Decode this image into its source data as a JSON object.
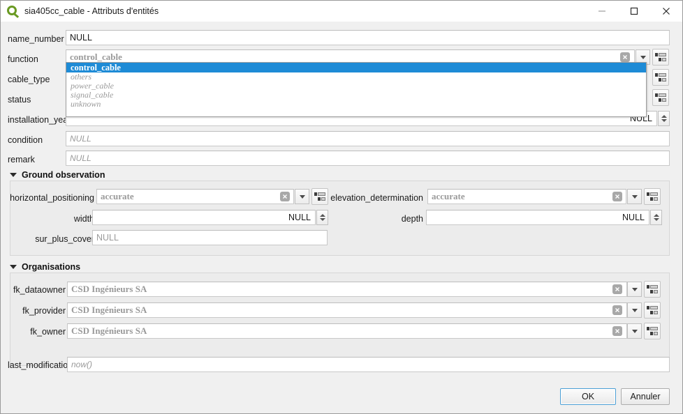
{
  "window": {
    "title": "sia405cc_cable - Attributs d'entités",
    "logo_icon": "qgis-logo-icon",
    "controls": [
      {
        "name": "minimize-button",
        "icon": "minimize-icon",
        "label": "—"
      },
      {
        "name": "maximize-button",
        "icon": "maximize-icon",
        "label": "☐"
      },
      {
        "name": "close-button",
        "icon": "close-icon",
        "label": "✕"
      }
    ]
  },
  "icons": {
    "clear": "clear-value-icon",
    "dropdown": "chevron-down-icon",
    "form_view": "open-form-icon",
    "spinner": "spinner-updown-icon",
    "collapse": "triangle-down-icon"
  },
  "fields": {
    "name_number": {
      "label": "name_number",
      "value": "NULL",
      "value_kind": "value"
    },
    "function": {
      "label": "function",
      "value": "control_cable",
      "value_kind": "combo-placeholder"
    },
    "cable_type": {
      "label": "cable_type",
      "value": "",
      "value_kind": "hidden-behind-popup"
    },
    "status": {
      "label": "status",
      "value": "",
      "value_kind": "hidden-behind-popup"
    },
    "installation_year": {
      "label": "installation_year",
      "value": "NULL",
      "value_kind": "numeric"
    },
    "condition": {
      "label": "condition",
      "value": "NULL",
      "value_kind": "placeholder"
    },
    "remark": {
      "label": "remark",
      "value": "NULL",
      "value_kind": "placeholder"
    },
    "horizontal_positioning": {
      "label": "horizontal_positioning",
      "value": "accurate",
      "value_kind": "combo-placeholder"
    },
    "elevation_determination": {
      "label": "elevation_determination",
      "value": "accurate",
      "value_kind": "combo-placeholder"
    },
    "width": {
      "label": "width",
      "value": "NULL",
      "value_kind": "numeric"
    },
    "depth": {
      "label": "depth",
      "value": "NULL",
      "value_kind": "numeric"
    },
    "sur_plus_cover": {
      "label": "sur_plus_cover",
      "value": "NULL",
      "value_kind": "placeholder-plain"
    },
    "fk_dataowner": {
      "label": "fk_dataowner",
      "value": "CSD Ingénieurs SA",
      "value_kind": "relation-ref"
    },
    "fk_provider": {
      "label": "fk_provider",
      "value": "CSD Ingénieurs SA",
      "value_kind": "relation-ref"
    },
    "fk_owner": {
      "label": "fk_owner",
      "value": "CSD Ingénieurs SA",
      "value_kind": "relation-ref"
    },
    "last_modification": {
      "label": "last_modification",
      "value": "now()",
      "value_kind": "placeholder"
    }
  },
  "groups": {
    "ground_observation": {
      "title": "Ground observation",
      "expanded": true
    },
    "organisations": {
      "title": "Organisations",
      "expanded": true
    }
  },
  "function_dropdown": {
    "open": true,
    "selected": "control_cable",
    "options": [
      "control_cable",
      "others",
      "power_cable",
      "signal_cable",
      "unknown"
    ]
  },
  "buttons": {
    "ok": "OK",
    "cancel": "Annuler"
  },
  "colors": {
    "highlight": "#1e8bd6",
    "window_bg": "#f0f0f0",
    "field_bg": "#ffffff",
    "placeholder": "#9a9a9a",
    "group_bg": "#ececec",
    "logo_green": "#6a9a23",
    "focus_border": "#4b9fd5"
  }
}
